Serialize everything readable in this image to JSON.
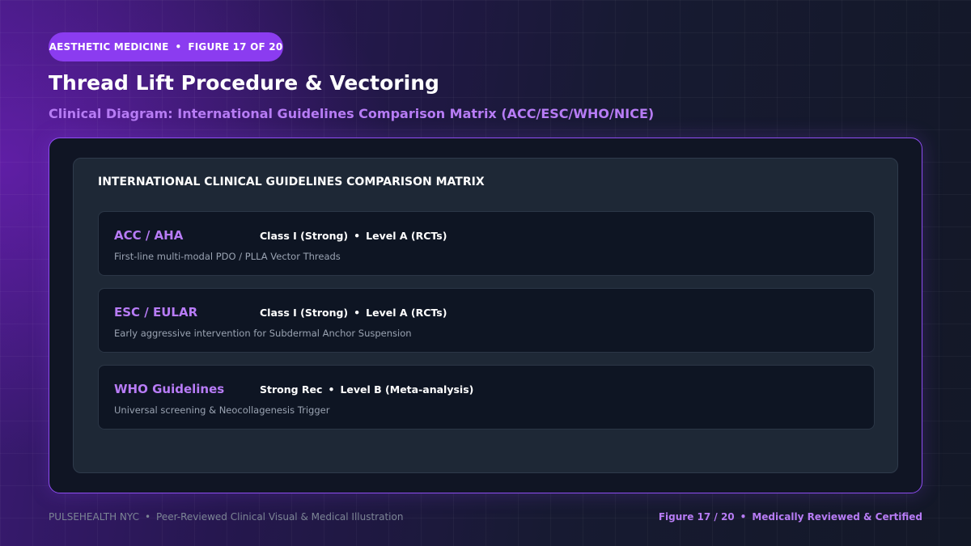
{
  "badge": {
    "category": "AESTHETIC MEDICINE",
    "figure": "FIGURE 17 OF 20"
  },
  "title": "Thread Lift Procedure & Vectoring",
  "subtitle": "Clinical Diagram: International Guidelines Comparison Matrix (ACC/ESC/WHO/NICE)",
  "matrix": {
    "heading": "INTERNATIONAL CLINICAL GUIDELINES COMPARISON MATRIX",
    "rows": [
      {
        "org": "ACC / AHA",
        "strength": "Class I (Strong)",
        "level": "Level A (RCTs)",
        "description": "First-line multi-modal PDO / PLLA Vector Threads"
      },
      {
        "org": "ESC / EULAR",
        "strength": "Class I (Strong)",
        "level": "Level A (RCTs)",
        "description": "Early aggressive intervention for Subdermal Anchor Suspension"
      },
      {
        "org": "WHO Guidelines",
        "strength": "Strong Rec",
        "level": "Level B (Meta-analysis)",
        "description": "Universal screening & Neocollagenesis Trigger"
      }
    ]
  },
  "footer": {
    "brand": "PULSEHEALTH NYC",
    "tagline": "Peer-Reviewed Clinical Visual & Medical Illustration",
    "figure": "Figure 17 / 20",
    "certification": "Medically Reviewed & Certified"
  },
  "separator": "•",
  "colors": {
    "accent": "#8b3cf0",
    "accent_text": "#b77cf5",
    "panel": "#101524",
    "card": "#0e1523"
  }
}
